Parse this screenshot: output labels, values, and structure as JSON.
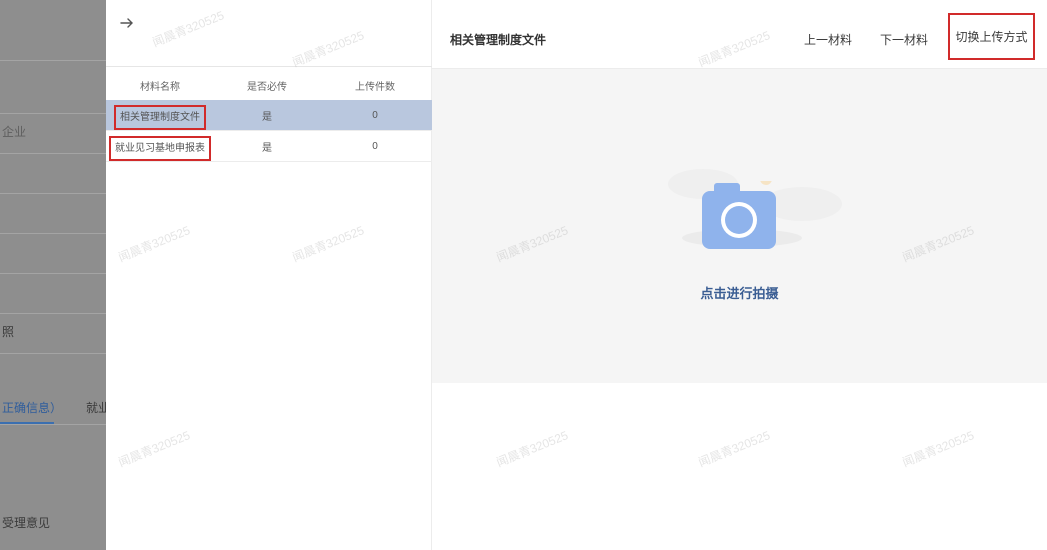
{
  "background_page": {
    "items": [
      {
        "label": "企业"
      },
      {
        "label": "照"
      },
      {
        "label": "正确信息）"
      },
      {
        "label": "就业"
      },
      {
        "label": "受理意见"
      }
    ]
  },
  "drawer": {
    "back_icon": "arrow-right-icon",
    "table": {
      "headers": [
        "材料名称",
        "是否必传",
        "上传件数"
      ],
      "rows": [
        {
          "name": "相关管理制度文件",
          "required": "是",
          "count": "0",
          "selected": true
        },
        {
          "name": "就业见习基地申报表",
          "required": "是",
          "count": "0",
          "selected": false
        }
      ]
    },
    "right_panel": {
      "title": "相关管理制度文件",
      "prev_label": "上一材料",
      "next_label": "下一材料",
      "switch_label": "切换上传方式",
      "camera_icon": "camera-icon",
      "capture_label": "点击进行拍摄"
    },
    "watermark_text": "闻晨青320525"
  },
  "colors": {
    "selected_row": "#b9c7de",
    "highlight_border": "#d12a2a",
    "camera_blue": "#8fb3ec",
    "label_blue": "#3a5d93"
  }
}
